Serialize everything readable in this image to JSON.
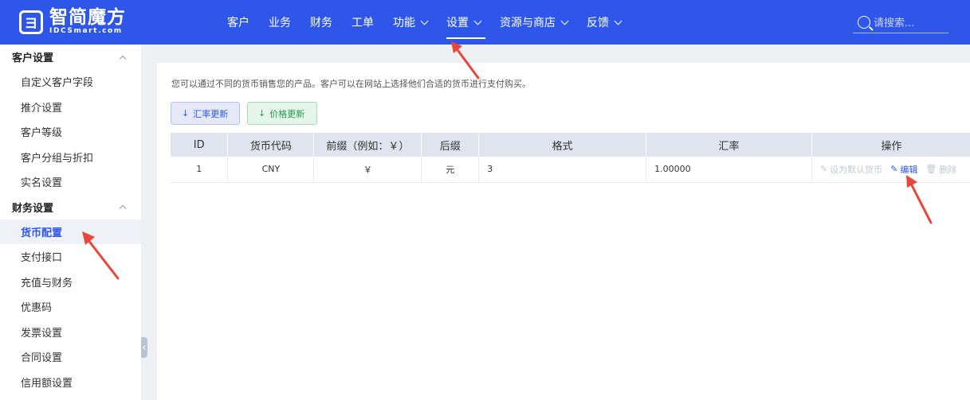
{
  "brand": {
    "name_cn": "智简魔方",
    "name_en": "IDCSmart.com",
    "logo_glyph": "ヨ"
  },
  "nav": [
    {
      "label": "客户",
      "dropdown": false
    },
    {
      "label": "业务",
      "dropdown": false
    },
    {
      "label": "财务",
      "dropdown": false
    },
    {
      "label": "工单",
      "dropdown": false
    },
    {
      "label": "功能",
      "dropdown": true
    },
    {
      "label": "设置",
      "dropdown": true,
      "active": true
    },
    {
      "label": "资源与商店",
      "dropdown": true
    },
    {
      "label": "反馈",
      "dropdown": true
    }
  ],
  "search": {
    "placeholder": "请搜索..."
  },
  "sidebar": {
    "group1": {
      "label": "客户设置",
      "items": [
        "自定义客户字段",
        "推介设置",
        "客户等级",
        "客户分组与折扣",
        "实名设置"
      ]
    },
    "group2": {
      "label": "财务设置",
      "items": [
        "货币配置",
        "支付接口",
        "充值与财务",
        "优惠码",
        "发票设置",
        "合同设置",
        "信用额设置"
      ],
      "active_index": 0
    }
  },
  "main": {
    "description": "您可以通过不同的货币销售您的产品。客户可以在网站上选择他们合适的货币进行支付购买。",
    "buttons": {
      "rate_update": "汇率更新",
      "price_update": "价格更新"
    },
    "table": {
      "headers": [
        "ID",
        "货币代码",
        "前缀（例如：￥）",
        "后缀",
        "格式",
        "汇率",
        "操作"
      ],
      "rows": [
        {
          "id": "1",
          "code": "CNY",
          "prefix": "￥",
          "suffix": "元",
          "format": "3",
          "rate": "1.00000",
          "actions": {
            "set_default": "设为默认货币",
            "edit": "编辑",
            "delete": "删除"
          }
        }
      ]
    }
  },
  "colors": {
    "primary": "#2e57e9",
    "annotation_arrow": "#e8463a"
  }
}
